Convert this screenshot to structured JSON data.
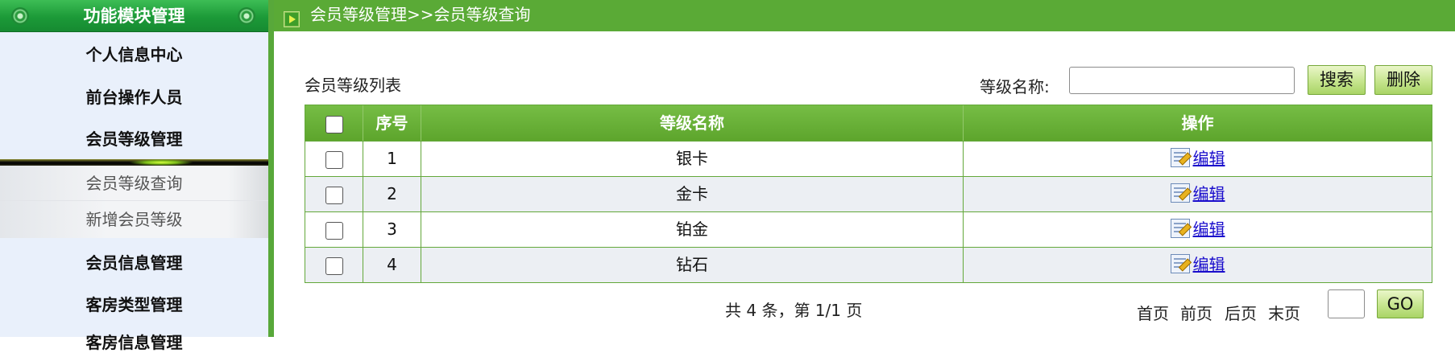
{
  "sidebar": {
    "title": "功能模块管理",
    "items": [
      {
        "label": "个人信息中心"
      },
      {
        "label": "前台操作人员"
      },
      {
        "label": "会员等级管理"
      },
      {
        "label": "会员信息管理"
      },
      {
        "label": "客房类型管理"
      },
      {
        "label": "客房信息管理"
      }
    ],
    "subitems": [
      {
        "label": "会员等级查询"
      },
      {
        "label": "新增会员等级"
      }
    ]
  },
  "topbar": {
    "breadcrumb": "会员等级管理>>会员等级查询"
  },
  "main": {
    "list_title": "会员等级列表",
    "filter_label": "等级名称:",
    "filter_value": "",
    "search_label": "搜索",
    "delete_label": "删除",
    "columns": [
      "",
      "序号",
      "等级名称",
      "操作"
    ],
    "rows": [
      {
        "index": "1",
        "name": "银卡",
        "action": "编辑"
      },
      {
        "index": "2",
        "name": "金卡",
        "action": "编辑"
      },
      {
        "index": "3",
        "name": "铂金",
        "action": "编辑"
      },
      {
        "index": "4",
        "name": "钻石",
        "action": "编辑"
      }
    ]
  },
  "pager": {
    "summary": "共 4 条，第 1/1 页",
    "first": "首页",
    "prev": "前页",
    "next": "后页",
    "last": "末页",
    "page_value": "",
    "go_label": "GO"
  },
  "colors": {
    "primary_green": "#5aaa36",
    "header_green": "#1c9a38",
    "link_blue": "#1a0dcc"
  }
}
